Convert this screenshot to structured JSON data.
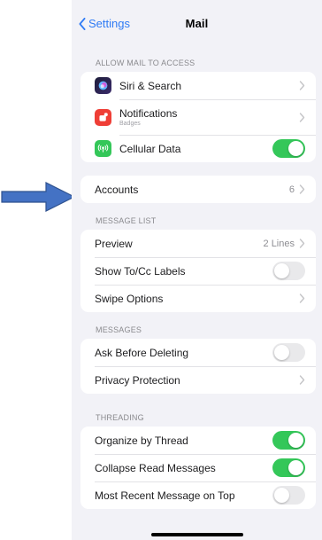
{
  "nav": {
    "back_label": "Settings",
    "title": "Mail"
  },
  "sections": {
    "allow_access": {
      "header": "ALLOW MAIL TO ACCESS",
      "siri": {
        "label": "Siri & Search",
        "icon": "siri-icon"
      },
      "notifications": {
        "label": "Notifications",
        "sublabel": "Badges",
        "icon": "notifications-icon",
        "icon_color": "#ef3e36"
      },
      "cellular": {
        "label": "Cellular Data",
        "icon": "antenna-icon",
        "icon_color": "#34c759",
        "enabled": true
      }
    },
    "accounts": {
      "label": "Accounts",
      "value": "6"
    },
    "message_list": {
      "header": "MESSAGE LIST",
      "preview": {
        "label": "Preview",
        "value": "2 Lines"
      },
      "show_tocc": {
        "label": "Show To/Cc Labels",
        "enabled": false
      },
      "swipe": {
        "label": "Swipe Options"
      }
    },
    "messages": {
      "header": "MESSAGES",
      "ask_before_deleting": {
        "label": "Ask Before Deleting",
        "enabled": false
      },
      "privacy": {
        "label": "Privacy Protection"
      }
    },
    "threading": {
      "header": "THREADING",
      "organize": {
        "label": "Organize by Thread",
        "enabled": true
      },
      "collapse": {
        "label": "Collapse Read Messages",
        "enabled": true
      },
      "most_recent": {
        "label": "Most Recent Message on Top",
        "enabled": false
      }
    }
  },
  "colors": {
    "accent": "#2f7bf5",
    "toggle_on": "#34c759",
    "toggle_off": "#e9e9eb",
    "annotation_arrow": "#3f6fb9"
  }
}
